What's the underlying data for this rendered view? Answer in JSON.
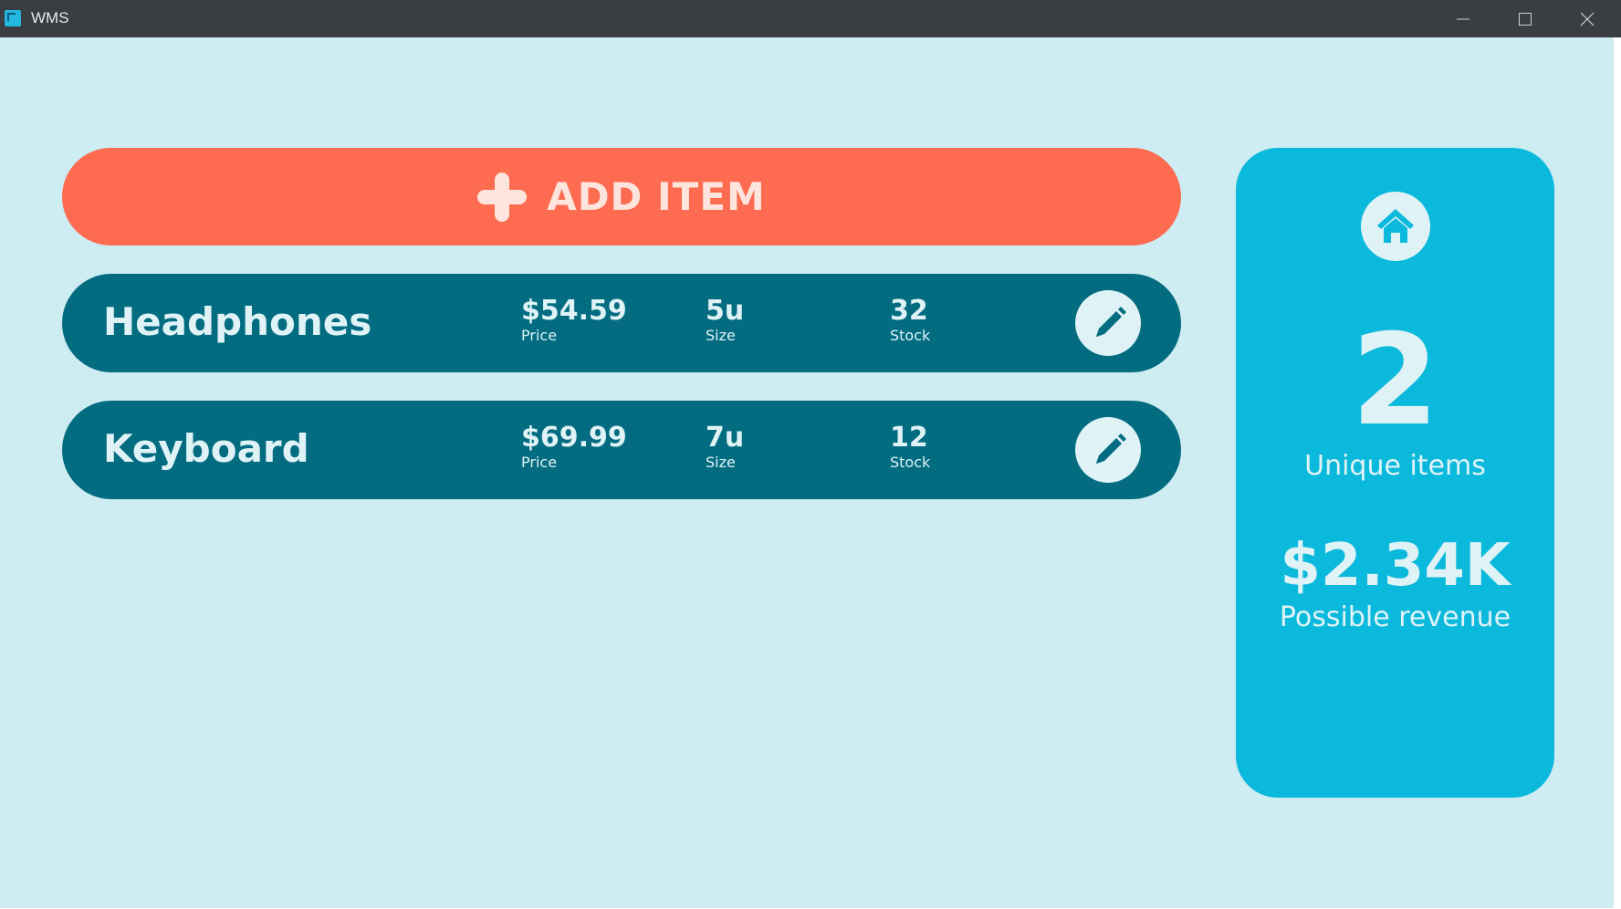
{
  "window": {
    "title": "WMS"
  },
  "toolbar": {
    "add_label": "ADD ITEM"
  },
  "items": [
    {
      "name": "Headphones",
      "price": "$54.59",
      "price_label": "Price",
      "size": "5u",
      "size_label": "Size",
      "stock": "32",
      "stock_label": "Stock"
    },
    {
      "name": "Keyboard",
      "price": "$69.99",
      "price_label": "Price",
      "size": "7u",
      "size_label": "Size",
      "stock": "12",
      "stock_label": "Stock"
    }
  ],
  "summary": {
    "unique_count": "2",
    "unique_label": "Unique items",
    "revenue": "$2.34K",
    "revenue_label": "Possible revenue"
  },
  "icons": {
    "add": "plus-icon",
    "edit": "pencil-icon",
    "home": "home-icon",
    "minimize": "minimize-icon",
    "maximize": "maximize-icon",
    "close": "close-icon"
  },
  "colors": {
    "background": "#ceedf2",
    "titlebar": "#3a3d41",
    "accent_coral": "#fd6b51",
    "card_teal": "#036c80",
    "panel_cyan": "#0bb9dc",
    "text_light": "#dff3f7"
  }
}
